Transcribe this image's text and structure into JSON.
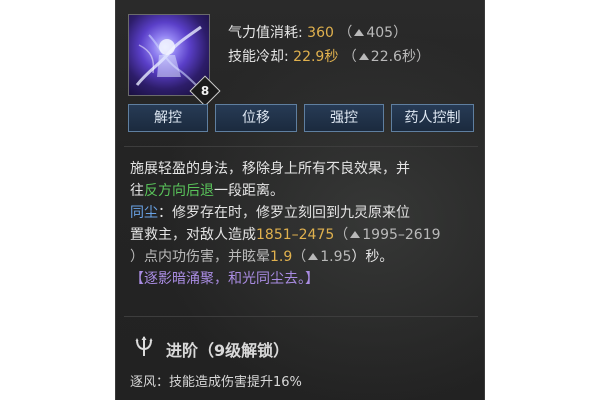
{
  "skill": {
    "level": "8",
    "qi_label": "气力值消耗:",
    "qi_value": "360",
    "qi_upgraded": "405",
    "cd_label": "技能冷却:",
    "cd_value": "22.9秒",
    "cd_upgraded": "22.6秒"
  },
  "tags": [
    "解控",
    "位移",
    "强控",
    "药人控制"
  ],
  "description": {
    "line1": "施展轻盈的身法，移除身上所有不良效果，并",
    "line2_pre": "往",
    "line2_highlight": "反方向后退",
    "line2_post": "一段距离。",
    "line3_name": "同尘",
    "line3_text": "：修罗存在时，修罗立刻回到九灵原来位",
    "line4_pre": "置救主，对敌人造成",
    "line4_damage": "1851–2475",
    "line4_open": "（",
    "line4_upgraded": "1995–2619",
    "line5_text": "）点内功伤害，并眩晕",
    "line5_stun": "1.9",
    "line5_open": "（",
    "line5_stun_upgraded": "1.95",
    "line5_post": "）秒。",
    "line6": "【逐影暗涌聚，和光同尘去。】"
  },
  "advance": {
    "title": "进阶（9级解锁）",
    "line": "逐风：技能造成伤害提升16%"
  },
  "colors": {
    "gold": "#e0b14e",
    "green": "#59c35a",
    "blue": "#6aa3e6",
    "purple": "#a98ce2"
  },
  "icons": [
    "skill-portrait",
    "level-diamond",
    "upgrade-arrow",
    "trident-emblem"
  ]
}
